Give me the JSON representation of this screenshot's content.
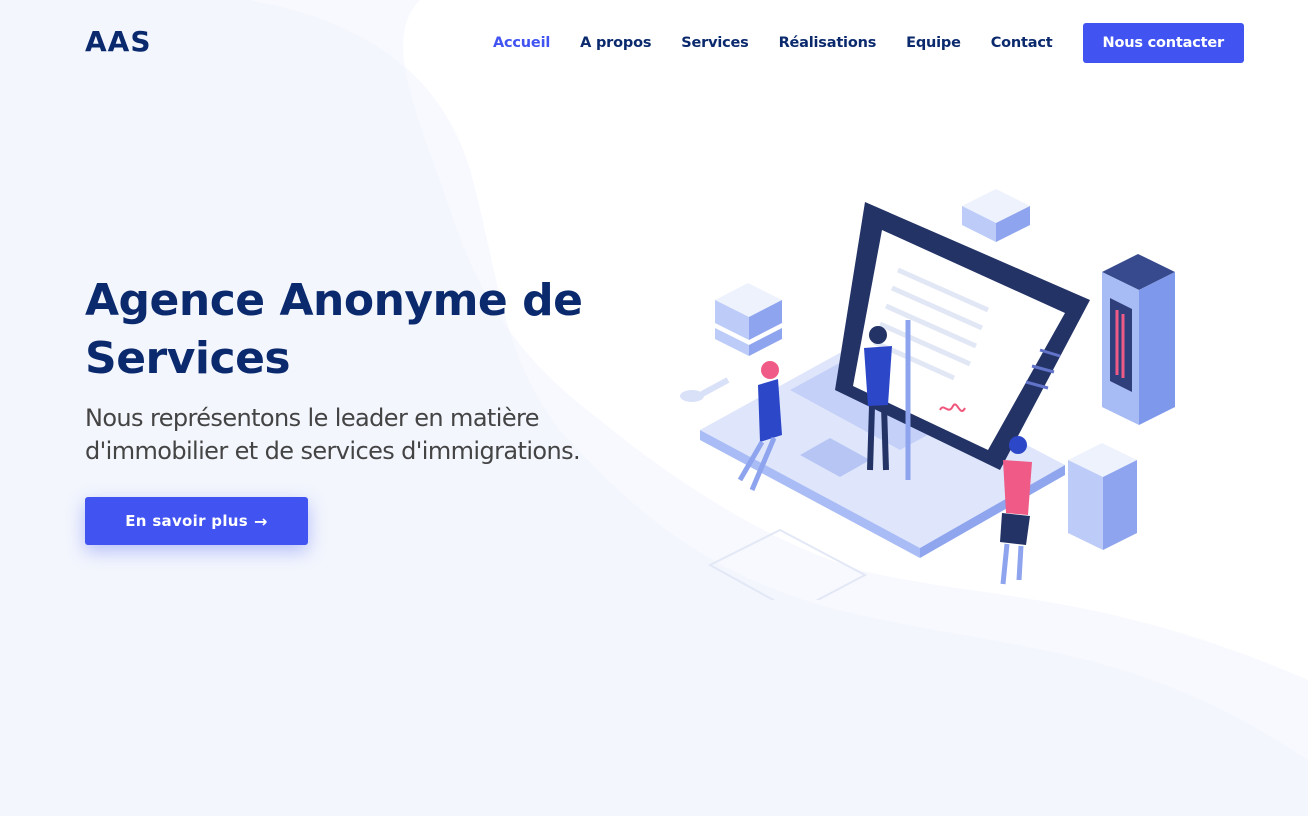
{
  "brand": {
    "logo_text": "AAS"
  },
  "nav": {
    "items": [
      {
        "label": "Accueil",
        "active": true
      },
      {
        "label": "A propos"
      },
      {
        "label": "Services"
      },
      {
        "label": "Réalisations"
      },
      {
        "label": "Equipe"
      },
      {
        "label": "Contact"
      }
    ],
    "cta_label": "Nous contacter"
  },
  "hero": {
    "title": "Agence Anonyme de Services",
    "subtitle": "Nous représentons le leader en matière d'immobilier et de services d'immigrations.",
    "button_label": "En savoir plus",
    "button_arrow": "→"
  },
  "colors": {
    "primary": "#4154f1",
    "heading": "#0b2a6e",
    "text": "#444444",
    "background_tint": "#f2f5fd"
  },
  "illustration": {
    "description_icons": [
      "laptop-icon",
      "document-icon",
      "server-icon",
      "key-icon",
      "person-icon"
    ]
  }
}
